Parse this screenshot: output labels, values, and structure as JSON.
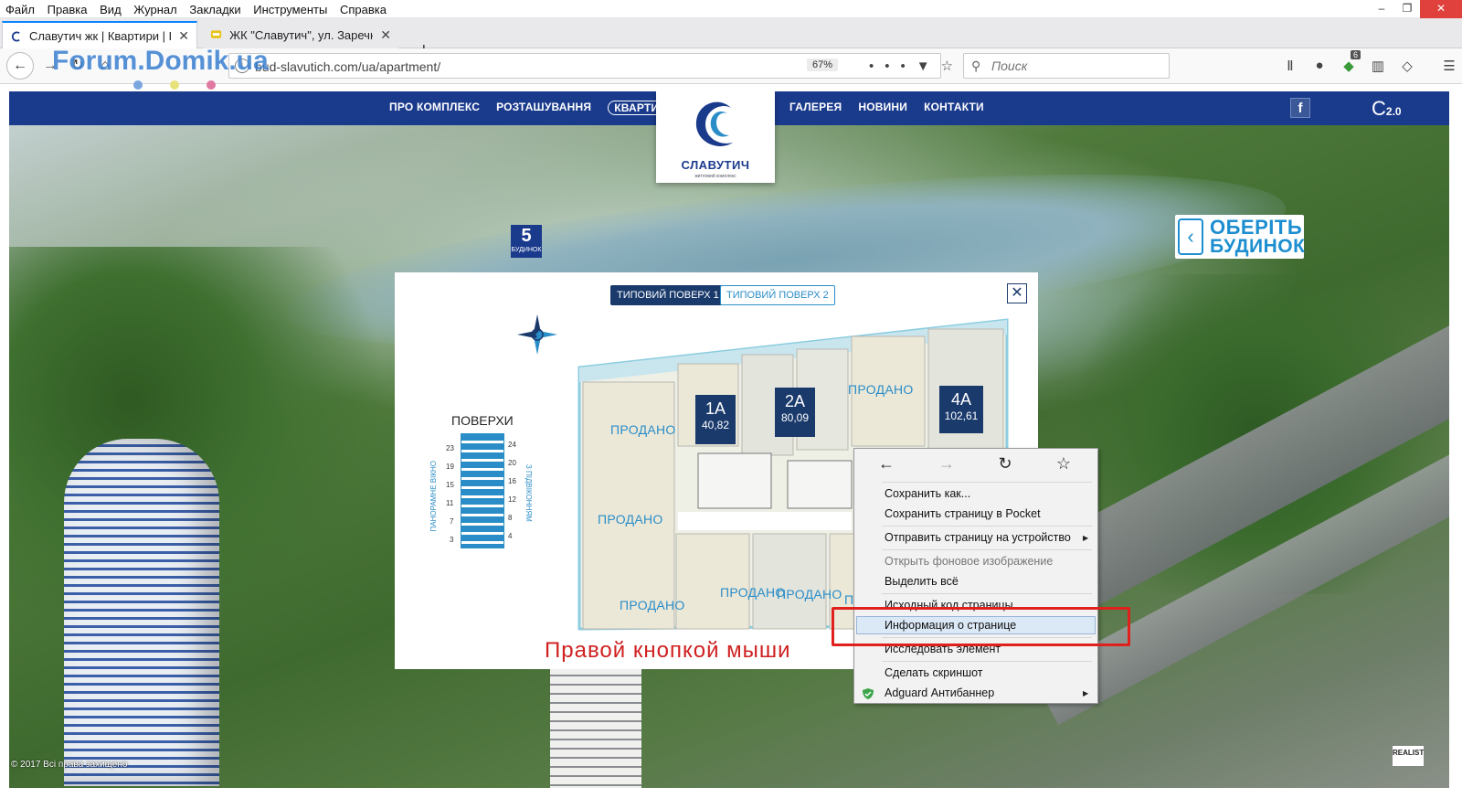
{
  "browser": {
    "menu": [
      "Файл",
      "Правка",
      "Вид",
      "Журнал",
      "Закладки",
      "Инструменты",
      "Справка"
    ],
    "tabs": [
      {
        "title": "Славутич жк | Квартири | Квар",
        "active": true
      },
      {
        "title": "ЖК \"Славутич\", ул. Заречная,",
        "active": false
      }
    ],
    "url": "bud-slavutich.com/ua/apartment/",
    "zoom": "67%",
    "search_placeholder": "Поиск",
    "badge_count": "6"
  },
  "watermark": "Forum.Domik.ua",
  "site": {
    "nav_left": [
      "ПРО КОМПЛЕКС",
      "РОЗТАШУВАННЯ",
      "КВАРТИРИ"
    ],
    "nav_right": [
      "ГАЛЕРЕЯ",
      "НОВИНИ",
      "КОНТАКТИ"
    ],
    "logo_name": "СЛАВУТИЧ",
    "logo_sub": "житловий комплекс",
    "version": "2.0",
    "facebook": "f",
    "choose_line1": "ОБЕРІТЬ",
    "choose_line2": "БУДИНОК",
    "building_number": "5",
    "building_label": "БУДИНОК",
    "copyright": "© 2017 Всі права захищено",
    "realist": "REALIST"
  },
  "modal": {
    "tabs": [
      "ТИПОВИЙ ПОВЕРХ 1",
      "ТИПОВИЙ ПОВЕРХ 2"
    ],
    "floors_title": "ПОВЕРХИ",
    "floors_left": [
      "23",
      "19",
      "15",
      "11",
      "7",
      "3"
    ],
    "floors_right": [
      "24",
      "20",
      "16",
      "12",
      "8",
      "4"
    ],
    "view_left": "ПАНОРАМНЕ ВІКНО",
    "view_right": "З ПІДВІКОННЯМ",
    "apartments": [
      {
        "num": "1А",
        "area": "40,82"
      },
      {
        "num": "2А",
        "area": "80,09"
      },
      {
        "num": "4А",
        "area": "102,61"
      }
    ],
    "sold_label": "ПРОДАНО",
    "sold_partial": "ПР",
    "caption": "Правой кнопкой мыши"
  },
  "context_menu": {
    "items": [
      {
        "label": "Сохранить как...",
        "disabled": false
      },
      {
        "label": "Сохранить страницу в Pocket",
        "disabled": false
      },
      {
        "label": "Отправить страницу на устройство",
        "disabled": false
      },
      {
        "label": "Открыть фоновое изображение",
        "disabled": true
      },
      {
        "label": "Выделить всё",
        "disabled": false
      },
      {
        "label": "Исходный код страницы",
        "disabled": false
      },
      {
        "label": "Информация о странице",
        "disabled": false
      },
      {
        "label": "Исследовать элемент",
        "disabled": false
      },
      {
        "label": "Сделать скриншот",
        "disabled": false
      },
      {
        "label": "Adguard Антибаннер",
        "disabled": false
      }
    ],
    "highlighted": "Информация о странице"
  },
  "colors": {
    "site_nav": "#1a3a8c",
    "accent": "#2a8dc8",
    "highlight_box": "#e0201c",
    "caption": "#d02020"
  }
}
